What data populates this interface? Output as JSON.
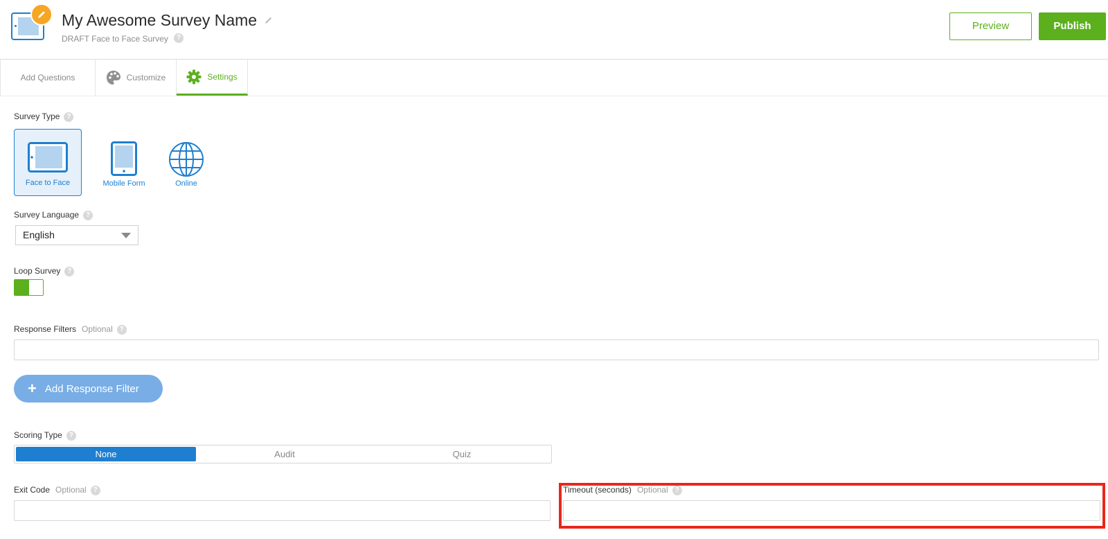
{
  "header": {
    "title": "My Awesome Survey Name",
    "subtitle": "DRAFT Face to Face Survey",
    "preview_label": "Preview",
    "publish_label": "Publish"
  },
  "tabs": [
    {
      "label": "Add Questions"
    },
    {
      "label": "Customize"
    },
    {
      "label": "Settings"
    }
  ],
  "settings": {
    "survey_type_label": "Survey Type",
    "survey_types": [
      {
        "label": "Face to Face",
        "selected": true
      },
      {
        "label": "Mobile Form",
        "selected": false
      },
      {
        "label": "Online",
        "selected": false
      }
    ],
    "language_label": "Survey Language",
    "language_value": "English",
    "loop_label": "Loop Survey",
    "loop_on": true,
    "filters_label": "Response Filters",
    "optional": "Optional",
    "add_filter_label": "Add Response Filter",
    "scoring_label": "Scoring Type",
    "scoring_options": [
      {
        "label": "None",
        "selected": true
      },
      {
        "label": "Audit",
        "selected": false
      },
      {
        "label": "Quiz",
        "selected": false
      }
    ],
    "exit_code_label": "Exit Code",
    "timeout_label": "Timeout (seconds)"
  },
  "help_glyph": "?",
  "colors": {
    "brand_green": "#5cb01e",
    "accent_blue": "#1e7fd0",
    "badge_orange": "#f6a623",
    "highlight_red": "#e8271a"
  }
}
